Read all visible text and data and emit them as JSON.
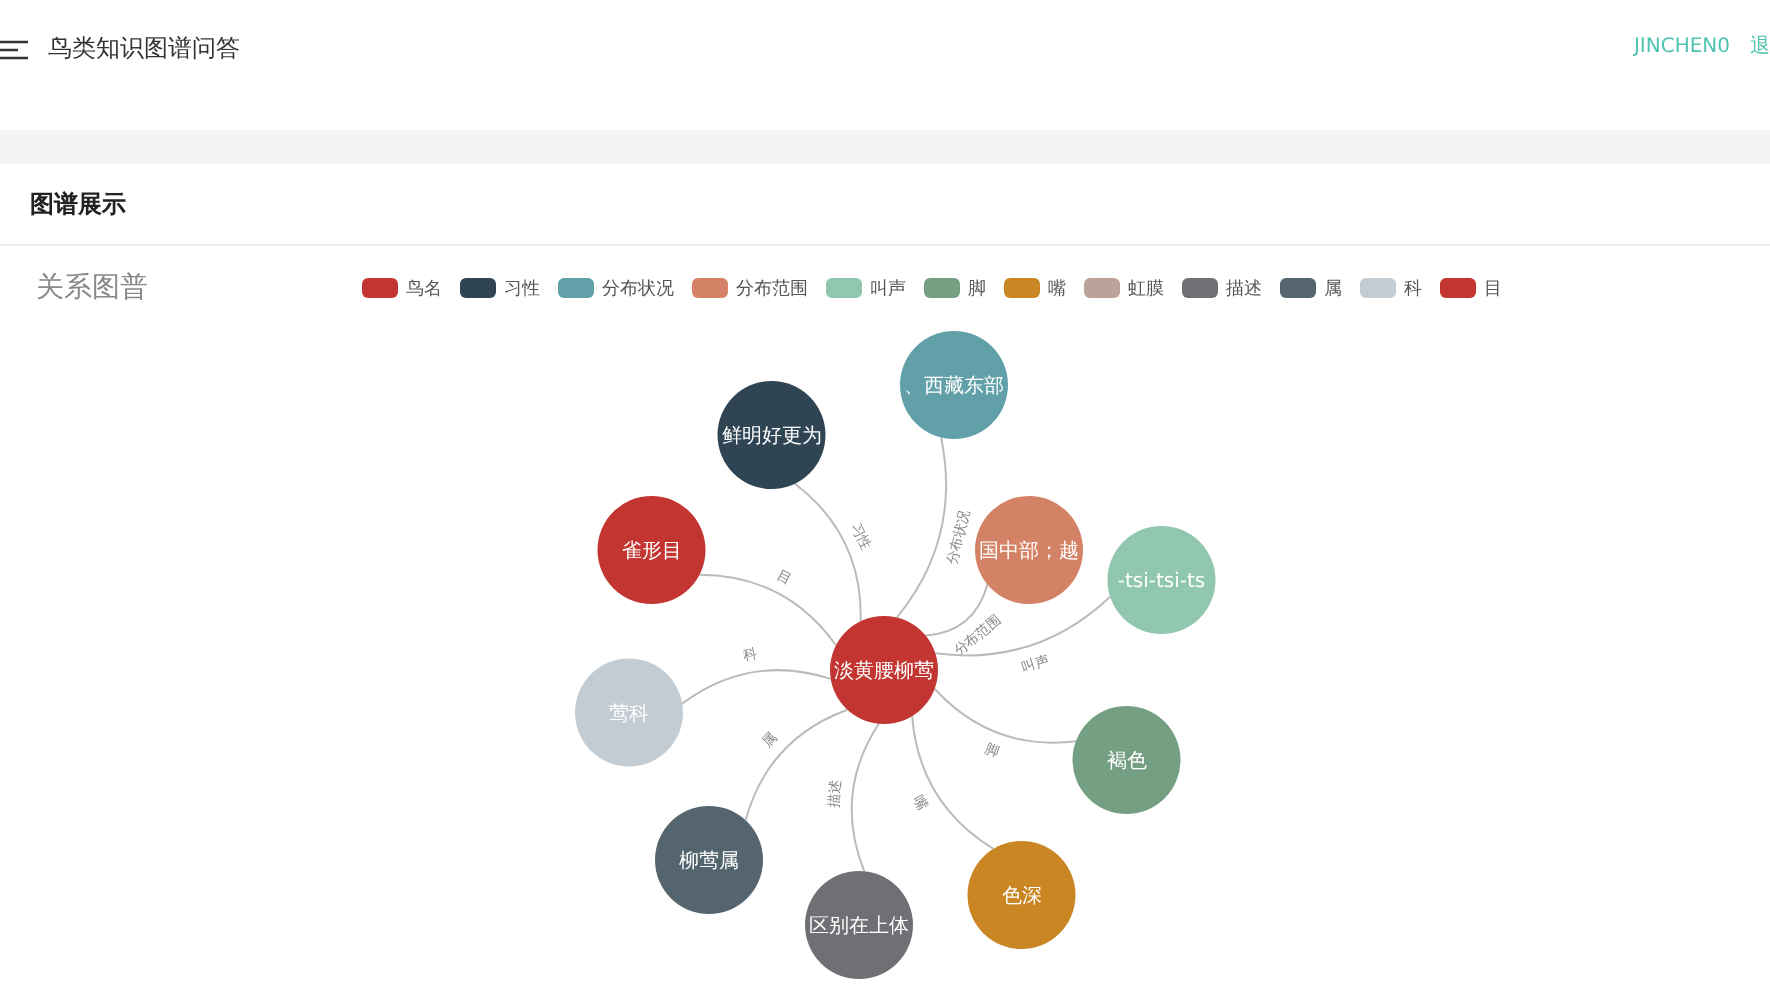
{
  "header": {
    "title": "鸟类知识图谱问答",
    "user": "JINCHEN0",
    "logout": "退"
  },
  "card": {
    "title": "图谱展示"
  },
  "graph": {
    "title": "关系图普",
    "legend": [
      {
        "name": "鸟名",
        "color": "#c23531"
      },
      {
        "name": "习性",
        "color": "#2f4554"
      },
      {
        "name": "分布状况",
        "color": "#61a0a8"
      },
      {
        "name": "分布范围",
        "color": "#d48265"
      },
      {
        "name": "叫声",
        "color": "#91c7ae"
      },
      {
        "name": "脚",
        "color": "#749f83"
      },
      {
        "name": "嘴",
        "color": "#ca8622"
      },
      {
        "name": "虹膜",
        "color": "#bda29a"
      },
      {
        "name": "描述",
        "color": "#6e7074"
      },
      {
        "name": "属",
        "color": "#546570"
      },
      {
        "name": "科",
        "color": "#c4ccd3"
      },
      {
        "name": "目",
        "color": "#c23531"
      }
    ],
    "center": {
      "label": "淡黄腰柳莺",
      "color": "#c23531"
    },
    "nodes": [
      {
        "label": "雀形目",
        "color": "#c23531",
        "relation": "目"
      },
      {
        "label": "鲜明好更为",
        "color": "#2f4554",
        "relation": "习性"
      },
      {
        "label": "、西藏东部",
        "color": "#61a0a8",
        "relation": "分布状况"
      },
      {
        "label": "国中部；越",
        "color": "#d48265",
        "relation": "分布范围"
      },
      {
        "label": "-tsi-tsi-ts",
        "color": "#91c7ae",
        "relation": "叫声"
      },
      {
        "label": "褐色",
        "color": "#749f83",
        "relation": "脚"
      },
      {
        "label": "色深",
        "color": "#ca8622",
        "relation": "嘴"
      },
      {
        "label": "区别在上体",
        "color": "#6e7074",
        "relation": "描述"
      },
      {
        "label": "柳莺属",
        "color": "#546570",
        "relation": "属"
      },
      {
        "label": "莺科",
        "color": "#c4ccd3",
        "relation": "科"
      }
    ]
  }
}
